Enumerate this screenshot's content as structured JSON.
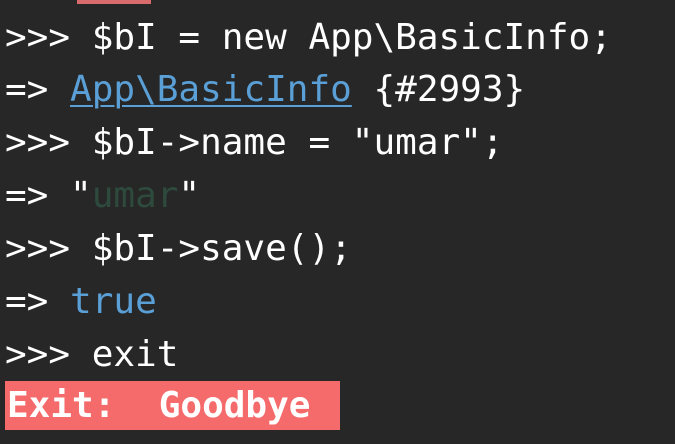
{
  "terminal": {
    "lines": [
      {
        "prompt": ">>>",
        "code": " $bI = new App\\BasicInfo;"
      },
      {
        "prompt": "=>",
        "link": "App\\BasicInfo",
        "rest": " {#2993}"
      },
      {
        "prompt": ">>>",
        "code": " $bI->name = \"umar\";"
      },
      {
        "prompt": "=>",
        "quote_open": " \"",
        "string_value": "umar",
        "quote_close": "\""
      },
      {
        "prompt": ">>>",
        "code": " $bI->save();"
      },
      {
        "prompt": "=>",
        "value": "true"
      },
      {
        "prompt": ">>>",
        "code": " exit"
      }
    ],
    "exit_banner": "Exit:  Goodbye"
  },
  "colors": {
    "background": "#272727",
    "text": "#ffffff",
    "link": "#5a9fd6",
    "muted_string": "#2d4a3d",
    "exit_banner_bg": "#f56b6b"
  }
}
